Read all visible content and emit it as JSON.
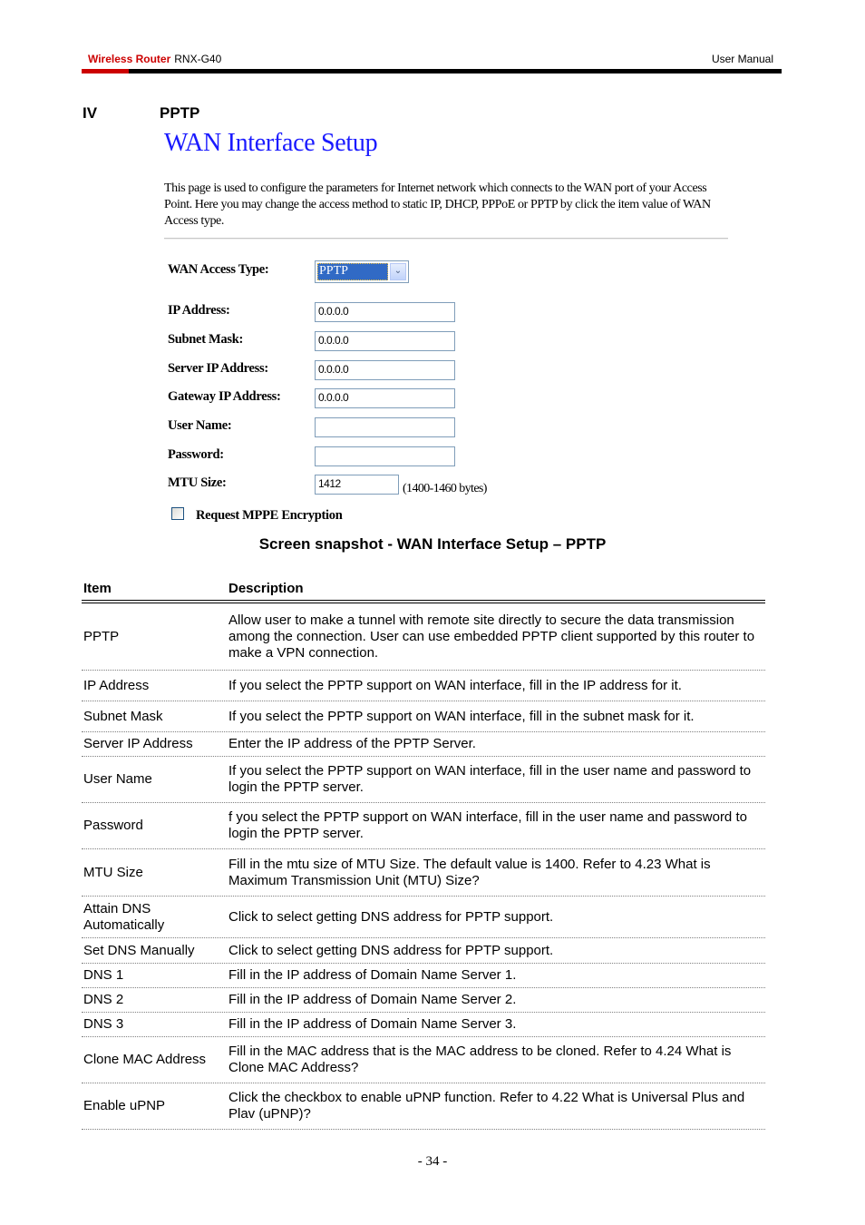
{
  "header": {
    "brand": "Wireless Router",
    "model": "RNX-G40",
    "doc_type": "User Manual",
    "brand_color": "#cc0000"
  },
  "section": {
    "number": "IV",
    "title": "PPTP"
  },
  "screenshot": {
    "title": "WAN Interface Setup",
    "title_color": "#1a1aff",
    "intro": "This page is used to configure the parameters for Internet network which connects to the WAN port of your Access Point. Here you may change the access method to static IP, DHCP, PPPoE or PPTP by click the item value of WAN Access type.",
    "wan_access_type": {
      "label": "WAN Access Type:",
      "selected": "PPTP"
    },
    "fields": [
      {
        "label": "IP Address:",
        "value": "0.0.0.0"
      },
      {
        "label": "Subnet Mask:",
        "value": "0.0.0.0"
      },
      {
        "label": "Server IP Address:",
        "value": "0.0.0.0"
      },
      {
        "label": "Gateway IP Address:",
        "value": "0.0.0.0"
      },
      {
        "label": "User Name:",
        "value": ""
      },
      {
        "label": "Password:",
        "value": ""
      },
      {
        "label": "MTU Size:",
        "value": "1412"
      }
    ],
    "mtu_hint": "(1400-1460 bytes)",
    "mppe_checkbox": {
      "label": "Request MPPE Encryption",
      "checked": false
    }
  },
  "caption": "Screen snapshot - WAN Interface Setup – PPTP",
  "table": {
    "headers": [
      "Item",
      "Description"
    ],
    "rows": [
      {
        "item": "PPTP",
        "description": "Allow user to make a tunnel with remote site directly to secure the data transmission among the connection. User can use embedded PPTP client supported by this router to make a VPN connection."
      },
      {
        "item": "IP Address",
        "description": "If you select the PPTP support on WAN interface, fill in the IP address for it."
      },
      {
        "item": "Subnet Mask",
        "description": "If you select the PPTP support on WAN interface, fill in the subnet mask for it."
      },
      {
        "item": "Server IP Address",
        "description": "Enter the IP address of the PPTP Server."
      },
      {
        "item": "User Name",
        "description": "If you select the PPTP support on WAN interface, fill in the user name and password to login the PPTP server."
      },
      {
        "item": "Password",
        "description": "f you select the PPTP support on WAN interface, fill in the user name and password to login the PPTP server."
      },
      {
        "item": "MTU Size",
        "description": "Fill in the mtu size of MTU Size. The default value is 1400. Refer to 4.23 What is Maximum Transmission Unit (MTU) Size?"
      },
      {
        "item": "Attain DNS Automatically",
        "description": "Click to select getting DNS address for PPTP support."
      },
      {
        "item": "Set DNS Manually",
        "description": "Click to select getting DNS address for PPTP support."
      },
      {
        "item": "DNS 1",
        "description": "Fill in the IP address of Domain Name Server 1."
      },
      {
        "item": "DNS 2",
        "description": "Fill in the IP address of Domain Name Server 2."
      },
      {
        "item": "DNS 3",
        "description": "Fill in the IP address of Domain Name Server 3."
      },
      {
        "item": "Clone MAC Address",
        "description": "Fill in the MAC address that is the MAC address to be cloned. Refer to 4.24 What is Clone MAC Address?"
      },
      {
        "item": "Enable uPNP",
        "description": "Click the checkbox to enable uPNP function. Refer to 4.22 What is Universal Plus and Plav (uPNP)?"
      }
    ]
  },
  "page_number": "- 34 -"
}
